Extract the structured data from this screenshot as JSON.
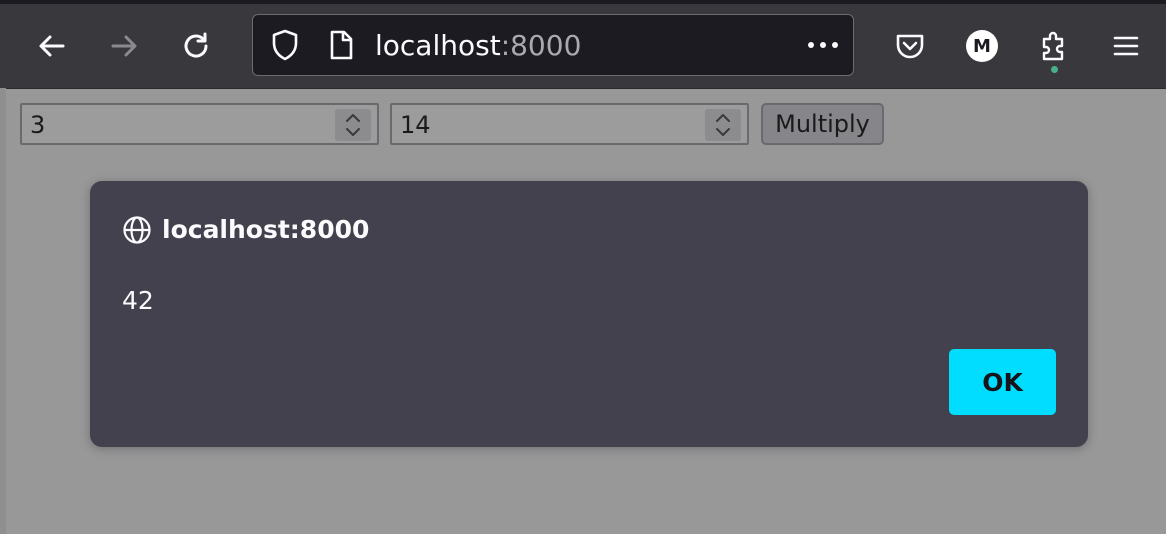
{
  "browser": {
    "url_host": "localhost",
    "url_port": ":8000",
    "account_initial": "M",
    "icons": [
      "back-arrow-icon",
      "forward-arrow-icon",
      "reload-icon",
      "shield-icon",
      "page-icon",
      "more-dots-icon",
      "pocket-icon",
      "account-icon",
      "extensions-icon",
      "menu-icon"
    ]
  },
  "page": {
    "input_a": "3",
    "input_b": "14",
    "multiply_label": "Multiply"
  },
  "dialog": {
    "title": "localhost:8000",
    "message": "42",
    "ok_label": "OK"
  },
  "colors": {
    "toolbar": "#39393d",
    "urlbar": "#1c1b22",
    "dialog": "#42414d",
    "ok_button": "#00ddff",
    "page_overlay": "#989899"
  }
}
